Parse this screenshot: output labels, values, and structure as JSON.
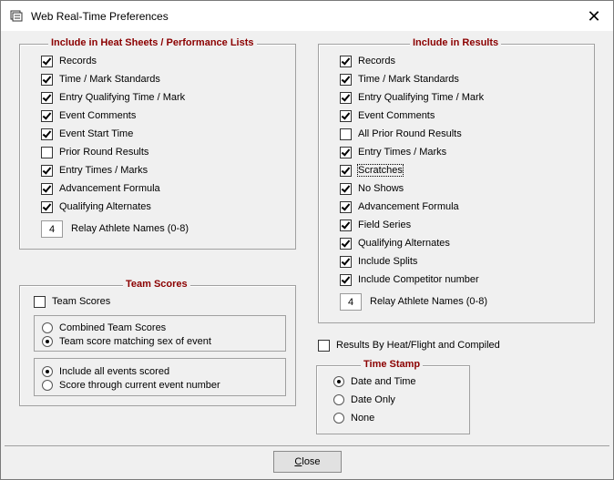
{
  "window": {
    "title": "Web Real-Time Preferences",
    "close_glyph": "✕"
  },
  "heat_sheets": {
    "legend": "Include in Heat Sheets / Performance Lists",
    "items": [
      {
        "label": "Records",
        "checked": true
      },
      {
        "label": "Time / Mark Standards",
        "checked": true
      },
      {
        "label": "Entry Qualifying Time / Mark",
        "checked": true
      },
      {
        "label": "Event Comments",
        "checked": true
      },
      {
        "label": "Event Start Time",
        "checked": true
      },
      {
        "label": "Prior Round Results",
        "checked": false
      },
      {
        "label": "Entry Times / Marks",
        "checked": true
      },
      {
        "label": "Advancement Formula",
        "checked": true
      },
      {
        "label": "Qualifying Alternates",
        "checked": true
      }
    ],
    "relay_value": "4",
    "relay_label": "Relay Athlete Names (0-8)"
  },
  "results": {
    "legend": "Include in Results",
    "items": [
      {
        "label": "Records",
        "checked": true
      },
      {
        "label": "Time / Mark Standards",
        "checked": true
      },
      {
        "label": "Entry Qualifying Time / Mark",
        "checked": true
      },
      {
        "label": "Event Comments",
        "checked": true
      },
      {
        "label": "All Prior Round Results",
        "checked": false
      },
      {
        "label": "Entry Times / Marks",
        "checked": true
      },
      {
        "label": "Scratches",
        "checked": true
      },
      {
        "label": "No Shows",
        "checked": true
      },
      {
        "label": "Advancement Formula",
        "checked": true
      },
      {
        "label": "Field Series",
        "checked": true
      },
      {
        "label": "Qualifying Alternates",
        "checked": true
      },
      {
        "label": "Include Splits",
        "checked": true
      },
      {
        "label": "Include Competitor number",
        "checked": true
      }
    ],
    "relay_value": "4",
    "relay_label": "Relay Athlete Names (0-8)"
  },
  "team_scores": {
    "legend": "Team Scores",
    "checkbox_label": "Team Scores",
    "checkbox_checked": false,
    "option_group_1": [
      {
        "label": "Combined Team Scores",
        "selected": false
      },
      {
        "label": "Team score matching sex of event",
        "selected": true
      }
    ],
    "option_group_2": [
      {
        "label": "Include all events scored",
        "selected": true
      },
      {
        "label": "Score through current event number",
        "selected": false
      }
    ]
  },
  "results_by_heat": {
    "label": "Results By Heat/Flight and Compiled",
    "checked": false
  },
  "time_stamp": {
    "legend": "Time Stamp",
    "options": [
      {
        "label": "Date and Time",
        "selected": true
      },
      {
        "label": "Date Only",
        "selected": false
      },
      {
        "label": "None",
        "selected": false
      }
    ]
  },
  "footer": {
    "close_label_underlined": "C",
    "close_label_rest": "lose"
  },
  "colors": {
    "legend_color": "#8b0000",
    "dialog_bg": "#f0f0f0"
  }
}
